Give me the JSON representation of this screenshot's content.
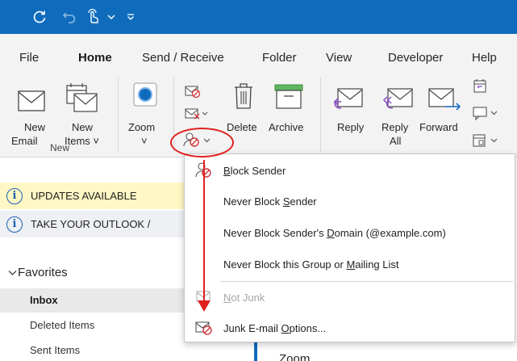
{
  "titlebar": {
    "icons": [
      "sync-icon",
      "undo-icon",
      "touch-mode-icon",
      "chevron-down-icon",
      "customize-quick-access-icon"
    ]
  },
  "tabs": [
    {
      "label": "File"
    },
    {
      "label": "Home",
      "active": true
    },
    {
      "label": "Send / Receive"
    },
    {
      "label": "Folder"
    },
    {
      "label": "View"
    },
    {
      "label": "Developer"
    },
    {
      "label": "Help"
    }
  ],
  "ribbon": {
    "new_email": "New\nEmail",
    "new_email_l1": "New",
    "new_email_l2": "Email",
    "new_items_l1": "New",
    "new_items_l2": "Items ˅",
    "zoom": "Zoom",
    "delete": "Delete",
    "archive": "Archive",
    "reply": "Reply",
    "reply_all_l1": "Reply",
    "reply_all_l2": "All",
    "forward": "Forward",
    "group_new": "New"
  },
  "banners": [
    {
      "text": "UPDATES AVAILABLE",
      "bg": "#fff8c5"
    },
    {
      "text": "TAKE YOUR OUTLOOK /",
      "bg": "#eef0f3"
    }
  ],
  "favorites": {
    "header": "Favorites",
    "items": [
      {
        "label": "Inbox",
        "selected": true
      },
      {
        "label": "Deleted Items"
      },
      {
        "label": "Sent Items"
      }
    ]
  },
  "reading_pane_peek": "Zoom",
  "junk_menu": {
    "items": [
      {
        "label": "Block Sender",
        "accel": "B",
        "icon": "block-sender-icon",
        "enabled": true
      },
      {
        "label": "Never Block Sender",
        "accel": "S",
        "enabled": true
      },
      {
        "label": "Never Block Sender's Domain (@example.com)",
        "accel": "D",
        "enabled": true
      },
      {
        "label": "Never Block this Group or Mailing List",
        "accel": "M",
        "enabled": true
      },
      {
        "label": "Not Junk",
        "accel": "N",
        "icon": "not-junk-icon",
        "enabled": false
      },
      {
        "label": "Junk E-mail Options...",
        "accel": "O",
        "icon": "junk-options-icon",
        "enabled": true
      }
    ]
  },
  "colors": {
    "titlebar": "#0f6cbd",
    "accent": "#0f6cbd",
    "annotation": "#e02020",
    "ribbon_bg": "#f3f3f3"
  }
}
